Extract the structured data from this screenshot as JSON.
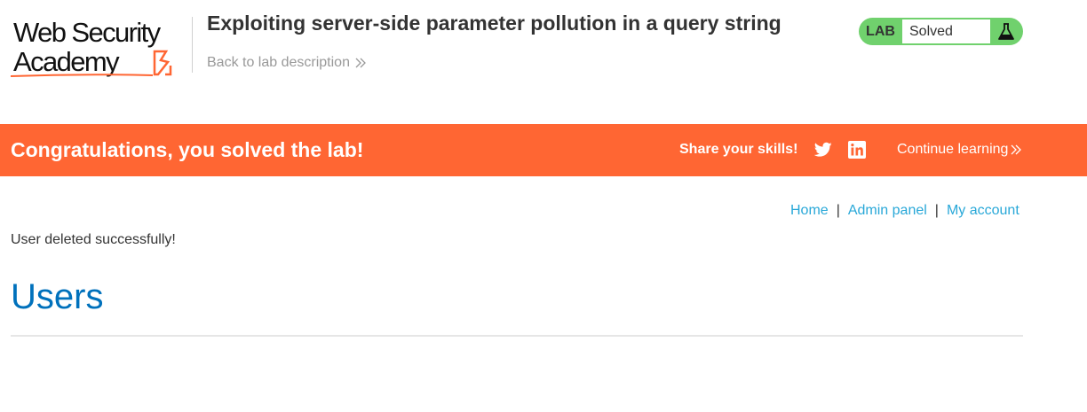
{
  "logo": {
    "line1": "Web Security",
    "line2": "Academy"
  },
  "lab": {
    "title": "Exploiting server-side parameter pollution in a query string",
    "back_link": "Back to lab description"
  },
  "status": {
    "tag": "LAB",
    "value": "Solved"
  },
  "banner": {
    "message": "Congratulations, you solved the lab!",
    "share_label": "Share your skills!",
    "continue_label": "Continue learning"
  },
  "nav": {
    "home": "Home",
    "admin_panel": "Admin panel",
    "my_account": "My account",
    "separator": "|"
  },
  "notice": "User deleted successfully!",
  "page": {
    "heading": "Users"
  },
  "colors": {
    "brand_orange": "#ff6633",
    "solved_green": "#70d16d",
    "link_blue": "#29a8d8",
    "heading_blue": "#0071bc"
  },
  "icons": [
    "lightning-bolt-icon",
    "chevron-double-right-icon",
    "flask-icon",
    "twitter-icon",
    "linkedin-icon"
  ]
}
